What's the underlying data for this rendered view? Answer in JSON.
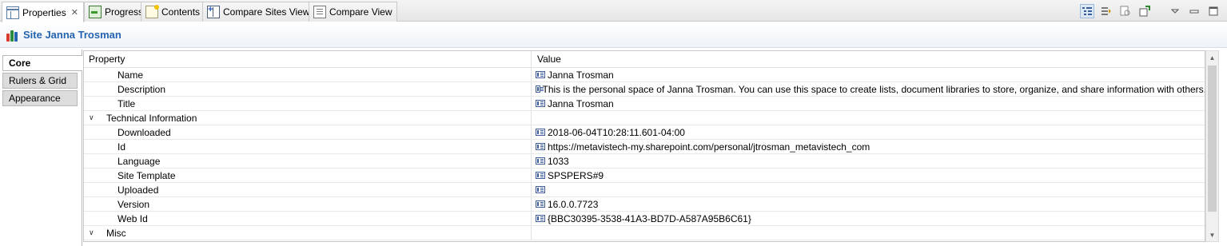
{
  "tabs": [
    {
      "label": "Properties",
      "icon": "properties-icon",
      "active": true,
      "closable": true
    },
    {
      "label": "Progress",
      "icon": "progress-icon"
    },
    {
      "label": "Contents",
      "icon": "contents-icon"
    },
    {
      "label": "Compare Sites View",
      "icon": "compare-sites-icon"
    },
    {
      "label": "Compare View",
      "icon": "compare-view-icon"
    }
  ],
  "close_glyph": "✕",
  "toolbar": {
    "icons": [
      "show-categories-icon",
      "show-advanced-icon",
      "filter-icon",
      "pin-icon",
      "view-menu-icon",
      "minimize-icon",
      "maximize-icon"
    ]
  },
  "header": {
    "title": "Site Janna Trosman",
    "icon": "site-icon"
  },
  "side_tabs": [
    "Core",
    "Rulers & Grid",
    "Appearance"
  ],
  "table": {
    "columns": {
      "property": "Property",
      "value": "Value"
    },
    "rows": [
      {
        "kind": "item",
        "name": "Name",
        "value": "Janna Trosman"
      },
      {
        "kind": "item",
        "name": "Description",
        "value": "This is the personal space of Janna Trosman. You can use this space to create lists, document libraries to store, organize, and share information with others."
      },
      {
        "kind": "item",
        "name": "Title",
        "value": "Janna Trosman"
      },
      {
        "kind": "group",
        "name": "Technical Information"
      },
      {
        "kind": "item",
        "name": "Downloaded",
        "value": "2018-06-04T10:28:11.601-04:00"
      },
      {
        "kind": "item",
        "name": "Id",
        "value": "https://metavistech-my.sharepoint.com/personal/jtrosman_metavistech_com"
      },
      {
        "kind": "item",
        "name": "Language",
        "value": "1033"
      },
      {
        "kind": "item",
        "name": "Site Template",
        "value": "SPSPERS#9"
      },
      {
        "kind": "item",
        "name": "Uploaded",
        "value": ""
      },
      {
        "kind": "item",
        "name": "Version",
        "value": "16.0.0.7723"
      },
      {
        "kind": "item",
        "name": "Web Id",
        "value": "{BBC30395-3538-41A3-BD7D-A587A95B6C61}"
      },
      {
        "kind": "group",
        "name": "Misc"
      }
    ]
  },
  "scrollbar": {
    "up": "▲",
    "down": "▼"
  },
  "colors": {
    "title": "#2463b0",
    "selection": "#dbe8f5"
  }
}
